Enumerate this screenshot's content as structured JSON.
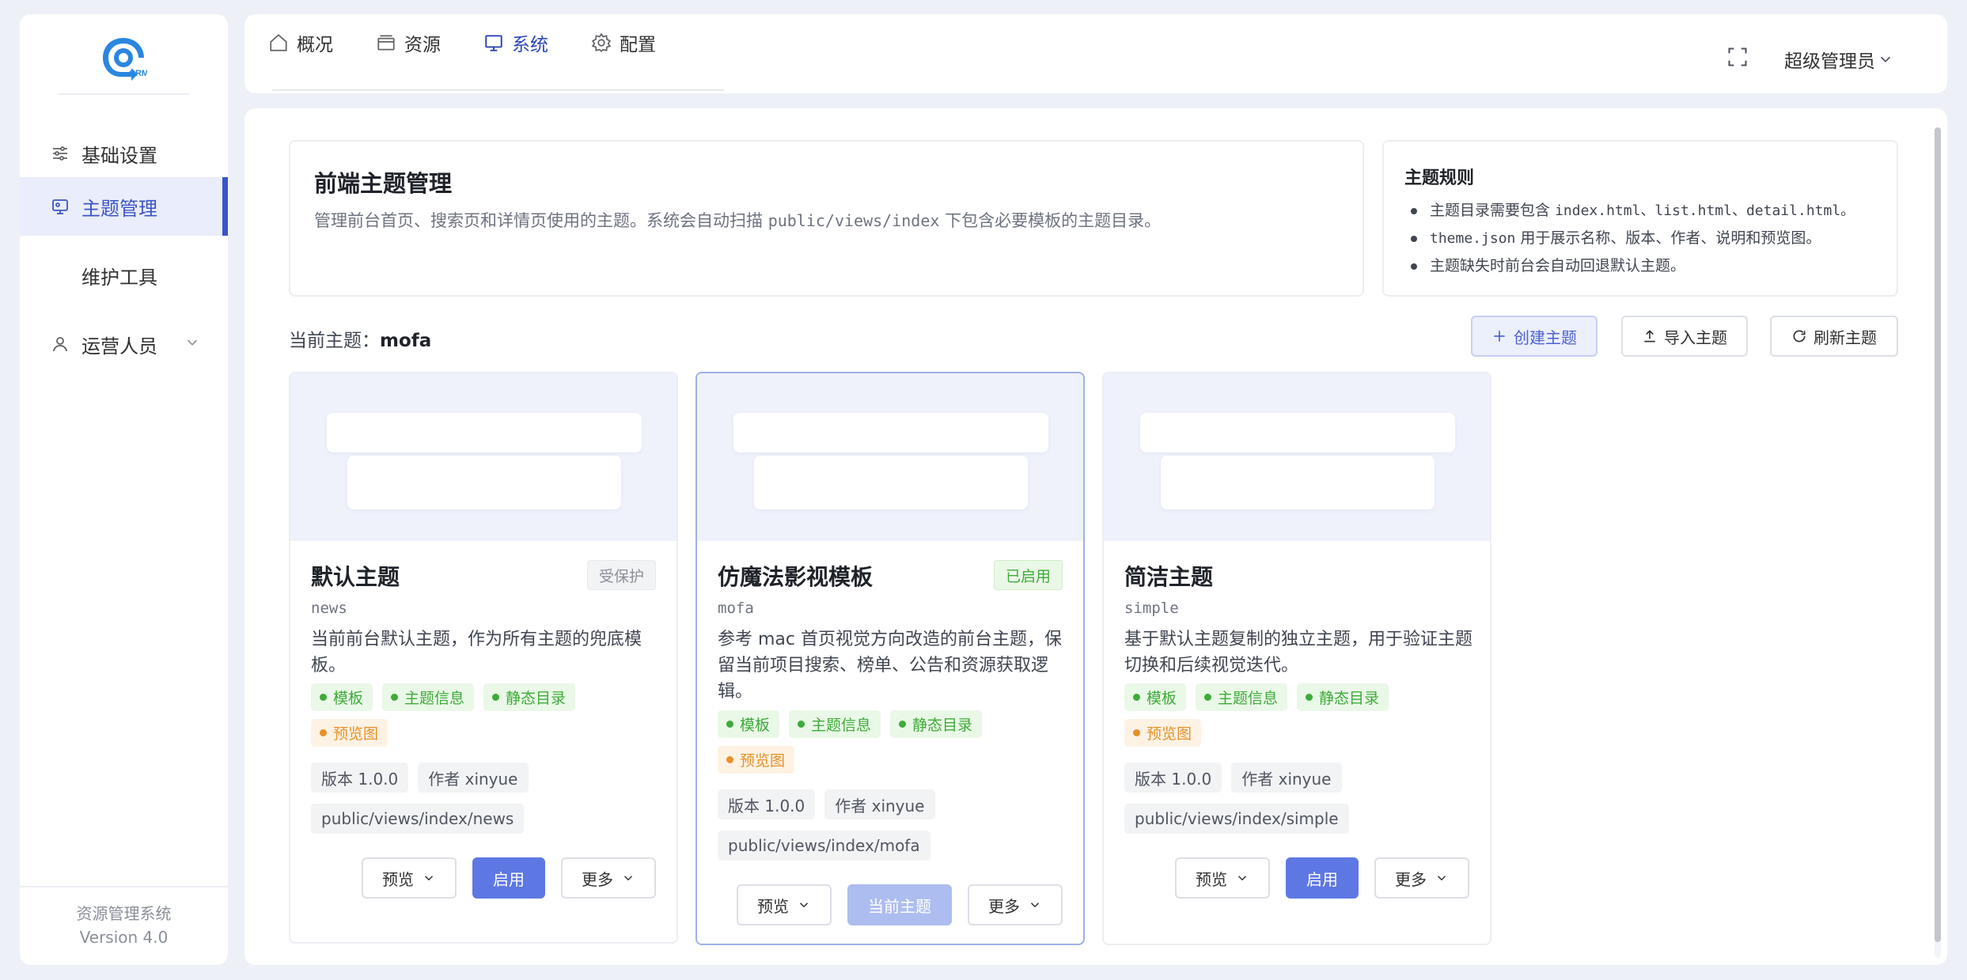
{
  "app": {
    "logo_text": "CRM"
  },
  "sidebar": {
    "items": [
      {
        "label": "基础设置",
        "icon": "sliders-icon"
      },
      {
        "label": "主题管理",
        "icon": "theme-icon",
        "active": true
      },
      {
        "label": "维护工具"
      },
      {
        "label": "运营人员",
        "icon": "user-icon",
        "expandable": true
      }
    ],
    "footer": {
      "name": "资源管理系统",
      "version": "Version 4.0"
    }
  },
  "topbar": {
    "tabs": [
      {
        "label": "概况",
        "icon": "home-icon"
      },
      {
        "label": "资源",
        "icon": "box-icon"
      },
      {
        "label": "系统",
        "icon": "monitor-icon",
        "active": true
      },
      {
        "label": "配置",
        "icon": "gear-icon"
      }
    ],
    "user": "超级管理员"
  },
  "intro": {
    "title": "前端主题管理",
    "desc_before": "管理前台首页、搜索页和详情页使用的主题。系统会自动扫描",
    "desc_path": "public/views/index",
    "desc_after": "下包含必要模板的主题目录。"
  },
  "rules": {
    "title": "主题规则",
    "r1_text": "主题目录需要包含",
    "r1_code": "index.html、list.html、detail.html。",
    "r2_code": "theme.json",
    "r2_text": "用于展示名称、版本、作者、说明和预览图。",
    "r3_text": "主题缺失时前台会自动回退默认主题。"
  },
  "current": {
    "label": "当前主题：",
    "value": "mofa"
  },
  "actions": {
    "create": "创建主题",
    "import": "导入主题",
    "refresh": "刷新主题"
  },
  "themes": [
    {
      "name": "默认主题",
      "slug": "news",
      "badge": "受保护",
      "desc": "当前前台默认主题，作为所有主题的兜底模板。",
      "tags": [
        "模板",
        "主题信息",
        "静态目录",
        "预览图"
      ],
      "version": "版本 1.0.0",
      "author": "作者 xinyue",
      "path": "public/views/index/news",
      "buttons": {
        "preview": "预览",
        "action": "启用",
        "more": "更多"
      }
    },
    {
      "name": "仿魔法影视模板",
      "slug": "mofa",
      "badge": "已启用",
      "desc": "参考 mac 首页视觉方向改造的前台主题，保留当前项目搜索、榜单、公告和资源获取逻辑。",
      "tags": [
        "模板",
        "主题信息",
        "静态目录",
        "预览图"
      ],
      "version": "版本 1.0.0",
      "author": "作者 xinyue",
      "path": "public/views/index/mofa",
      "buttons": {
        "preview": "预览",
        "action": "当前主题",
        "more": "更多"
      }
    },
    {
      "name": "简洁主题",
      "slug": "simple",
      "badge": "",
      "desc": "基于默认主题复制的独立主题，用于验证主题切换和后续视觉迭代。",
      "tags": [
        "模板",
        "主题信息",
        "静态目录",
        "预览图"
      ],
      "version": "版本 1.0.0",
      "author": "作者 xinyue",
      "path": "public/views/index/simple",
      "buttons": {
        "preview": "预览",
        "action": "启用",
        "more": "更多"
      }
    }
  ],
  "colors": {
    "primary": "#5d78e3",
    "active_nav": "#3b55c6",
    "success": "#3eab3a",
    "warning": "#e8912a"
  }
}
